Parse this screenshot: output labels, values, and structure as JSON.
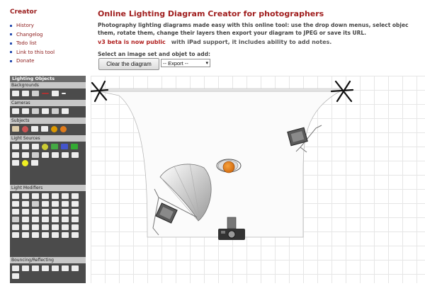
{
  "sidebar": {
    "title": "Creator",
    "links": [
      {
        "label": "History"
      },
      {
        "label": "Changelog"
      },
      {
        "label": "Todo list"
      },
      {
        "label": "Link to this tool"
      },
      {
        "label": "Donate"
      }
    ]
  },
  "header": {
    "title": "Online Lighting Diagram Creator for photographers",
    "description": "Photography lighting diagrams made easy with this online tool: use the drop down menus, select objec them, rotate them, change their layers then export your diagram to JPEG or save its URL.",
    "beta_link": "v3 beta is now public",
    "beta_text": "with iPad support, it includes ability to add notes.",
    "select_hint": "Select an image set and objet to add:"
  },
  "toolbar": {
    "clear_label": "Clear the diagram",
    "export_value": "-- Export --"
  },
  "objects_panel": {
    "title": "Lighting Objects",
    "groups": [
      {
        "label": "Backgrounds"
      },
      {
        "label": "Cameras"
      },
      {
        "label": "Subjects"
      },
      {
        "label": "Light Sources"
      },
      {
        "label": "Light Modifiers"
      },
      {
        "label": "Bouncing/Reflecting"
      }
    ]
  },
  "colors": {
    "accent": "#a01e1e",
    "panel_bg": "#4b4b4b",
    "subject_orange": "#e07b1a"
  }
}
